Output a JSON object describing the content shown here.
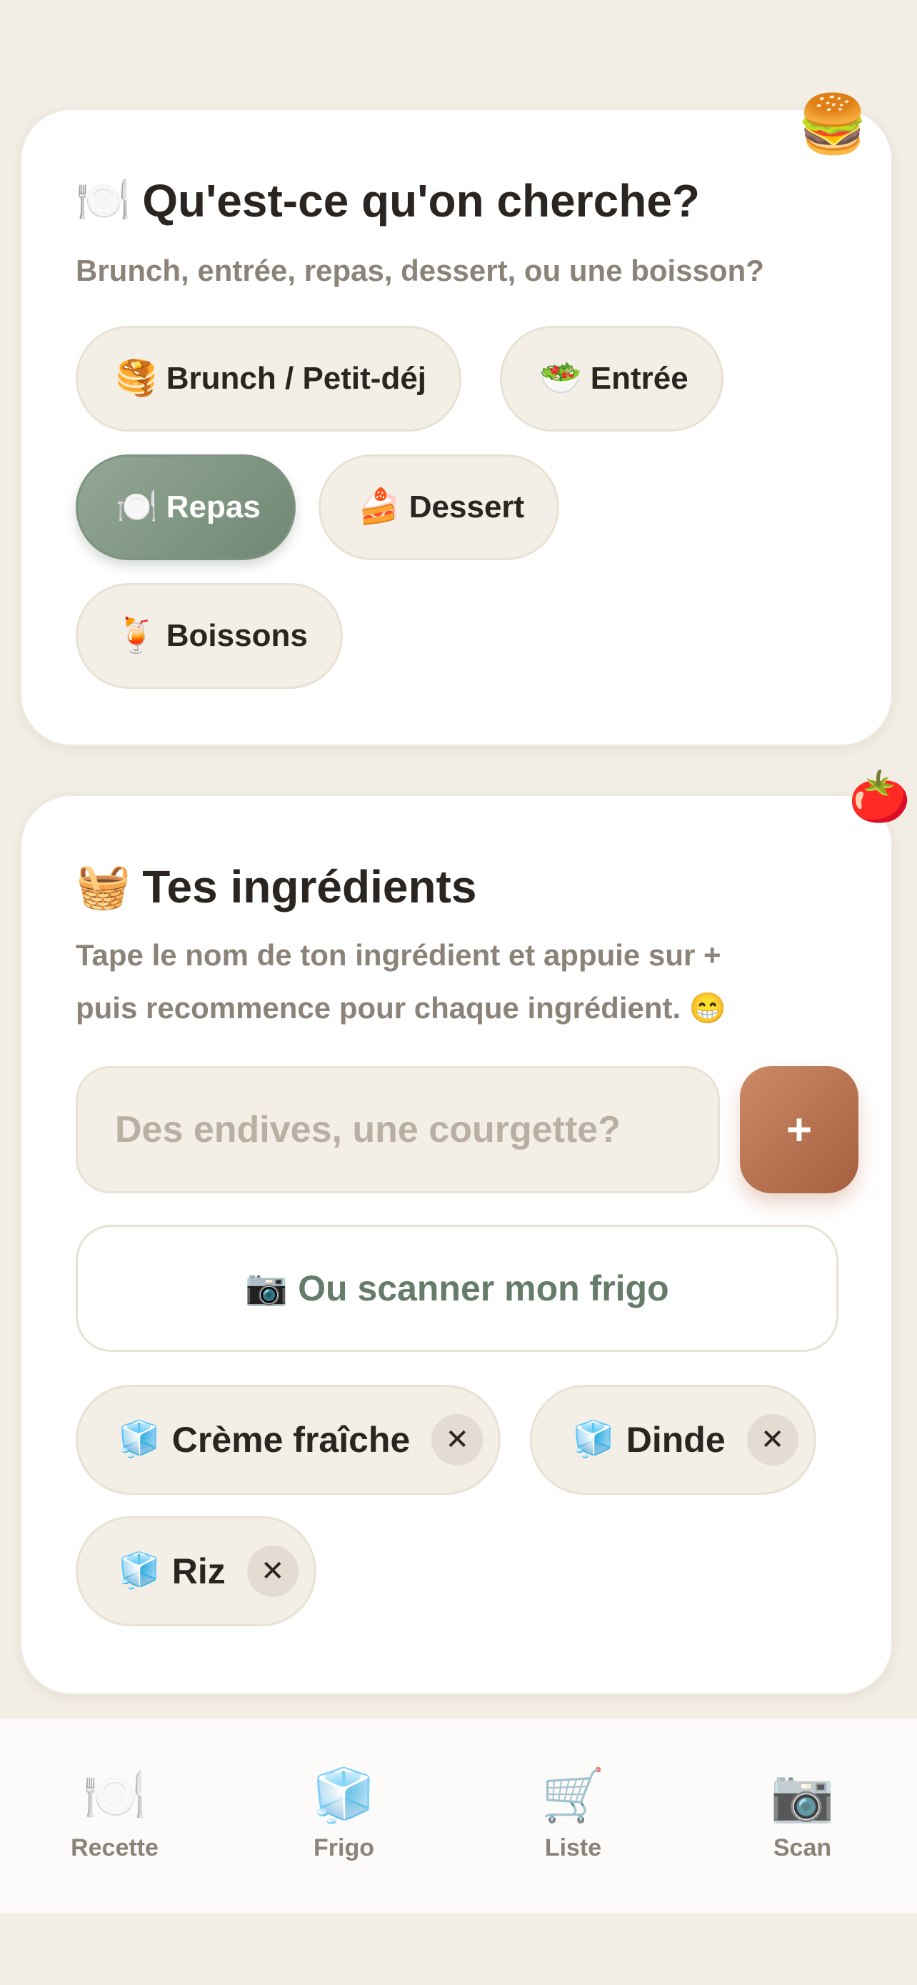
{
  "category_card": {
    "title_emoji": "🍽️",
    "title": "Qu'est-ce qu'on cherche?",
    "subtitle": "Brunch, entrée, repas, dessert, ou une boisson?",
    "deco_emoji": "🍔",
    "options": [
      {
        "emoji": "🥞",
        "label": "Brunch / Petit-déj",
        "selected": false
      },
      {
        "emoji": "🥗",
        "label": "Entrée",
        "selected": false
      },
      {
        "emoji": "🍽️",
        "label": "Repas",
        "selected": true
      },
      {
        "emoji": "🍰",
        "label": "Dessert",
        "selected": false
      },
      {
        "emoji": "🍹",
        "label": "Boissons",
        "selected": false
      }
    ]
  },
  "ingredients_card": {
    "title_emoji": "🧺",
    "title": "Tes ingrédients",
    "subtitle_line1": "Tape le nom de ton ingrédient et appuie sur +",
    "subtitle_line2": "puis recommence pour chaque ingrédient. 😁",
    "deco_emoji": "🍅",
    "input_placeholder": "Des endives, une courgette?",
    "add_label": "+",
    "scan_emoji": "📷",
    "scan_label": "Ou scanner mon frigo",
    "remove_symbol": "✕",
    "items": [
      {
        "emoji": "🧊",
        "label": "Crème fraîche"
      },
      {
        "emoji": "🧊",
        "label": "Dinde"
      },
      {
        "emoji": "🧊",
        "label": "Riz"
      }
    ]
  },
  "tabbar": {
    "tabs": [
      {
        "icon": "🍽️",
        "label": "Recette"
      },
      {
        "icon": "🧊",
        "label": "Frigo"
      },
      {
        "icon": "🛒",
        "label": "Liste"
      },
      {
        "icon": "📷",
        "label": "Scan"
      }
    ]
  },
  "colors": {
    "background": "#f2ede5",
    "selected_chip": "#7d937f",
    "add_button": "#b86f4f",
    "scan_text": "#667c6a"
  }
}
